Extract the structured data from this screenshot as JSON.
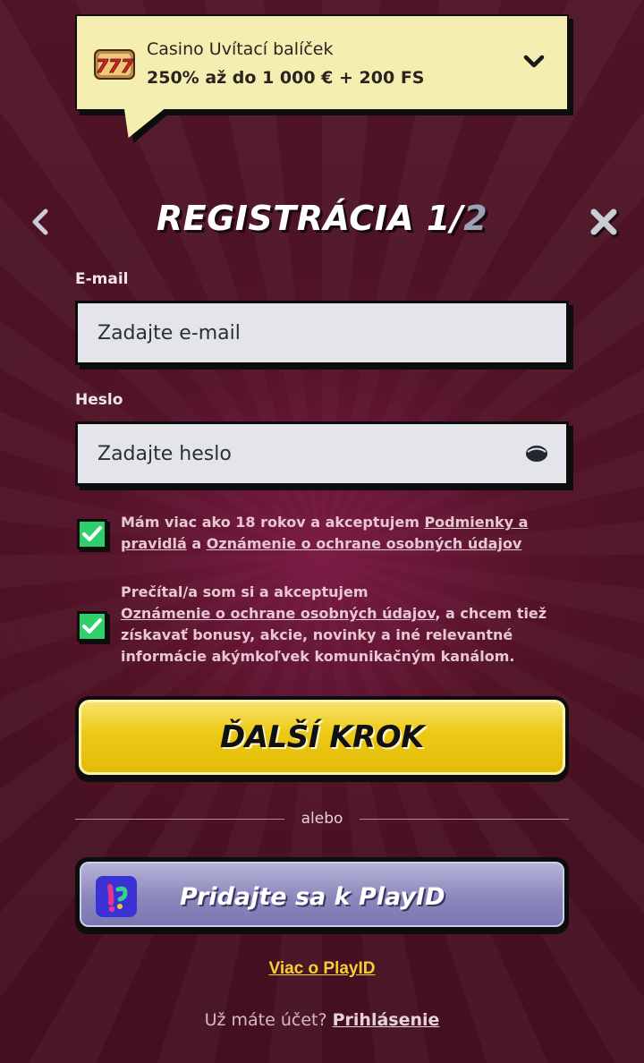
{
  "promo": {
    "title": "Casino Uvítací balíček",
    "subtitle": "250% až do 1 000 € + 200 FS",
    "icon": "slot-777-icon"
  },
  "header": {
    "title_main": "REGISTRÁCIA 1/",
    "title_step": "2"
  },
  "email": {
    "label": "E-mail",
    "placeholder": "Zadajte e-mail"
  },
  "password": {
    "label": "Heslo",
    "placeholder": "Zadajte heslo",
    "icon": "eye-icon"
  },
  "consent_age": {
    "checked": true,
    "text_prefix": "Mám viac ako 18 rokov a akceptujem ",
    "link_terms": "Podmienky a pravidlá",
    "text_mid": " a ",
    "link_privacy": "Oznámenie o ochrane osobných údajov"
  },
  "consent_marketing": {
    "checked": true,
    "text_prefix": "Prečítal/a som si a akceptujem",
    "link_privacy": "Oznámenie o ochrane osobných údajov",
    "text_suffix": ", a chcem tiež získavať bonusy, akcie, novinky a iné relevantné informácie akýmkoľvek komunikačným kanálom."
  },
  "next_button": {
    "label": "ĎALŠÍ KROK"
  },
  "divider": {
    "text": "alebo"
  },
  "playid": {
    "label": "Pridajte sa k PlayID",
    "more_link": "Viac o PlayID"
  },
  "login": {
    "question": "Už máte účet?",
    "link": "Prihlásenie"
  },
  "colors": {
    "background": "#4a1424",
    "promo_bg": "#f4efb0",
    "next_button": "#ecc914",
    "checkbox": "#2fcf6b",
    "playid_button": "#8c88bd",
    "link_yellow": "#f5cf38"
  }
}
